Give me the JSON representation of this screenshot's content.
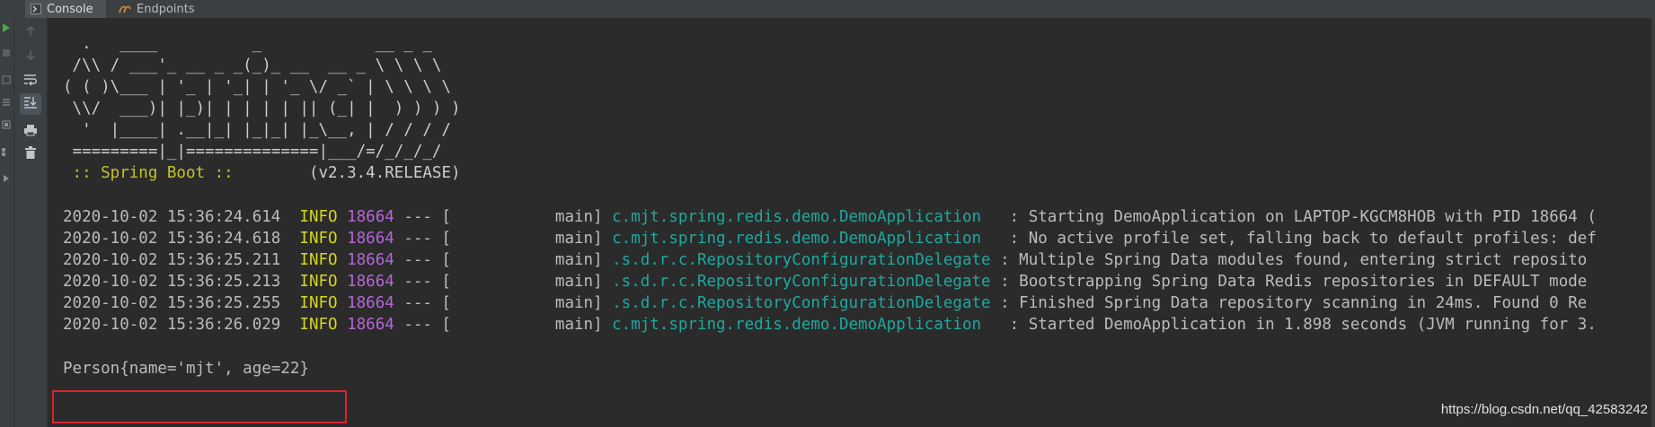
{
  "tabs": [
    {
      "label": "Console",
      "icon": "console-icon",
      "active": true
    },
    {
      "label": "Endpoints",
      "icon": "endpoints-icon",
      "active": false
    }
  ],
  "toolbar": {
    "buttons": [
      {
        "name": "scroll-up-button",
        "icon": "arrow-up-icon"
      },
      {
        "name": "scroll-down-button",
        "icon": "arrow-down-icon"
      },
      {
        "name": "soft-wrap-button",
        "icon": "soft-wrap-icon"
      },
      {
        "name": "scroll-to-end-button",
        "icon": "scroll-to-end-icon",
        "selected": true
      },
      {
        "name": "print-button",
        "icon": "print-icon"
      },
      {
        "name": "clear-all-button",
        "icon": "trash-icon"
      }
    ]
  },
  "banner": [
    "  .   ____          _            __ _ _",
    " /\\\\ / ___'_ __ _ _(_)_ __  __ _ \\ \\ \\ \\",
    "( ( )\\___ | '_ | '_| | '_ \\/ _` | \\ \\ \\ \\",
    " \\\\/  ___)| |_)| | | | | || (_| |  ) ) ) )",
    "  '  |____| .__|_| |_|_| |_\\__, | / / / /",
    " =========|_|==============|___/=/_/_/_/"
  ],
  "spring_line": {
    "label": " :: Spring Boot :: ",
    "version": "       (v2.3.4.RELEASE)"
  },
  "log_lines": [
    {
      "timestamp": "2020-10-02 15:36:24.614",
      "level": "INFO",
      "pid": "18664",
      "sep": " --- [           main] ",
      "logger": "c.mjt.spring.redis.demo.DemoApplication  ",
      "message": " : Starting DemoApplication on LAPTOP-KGCM8HOB with PID 18664 ("
    },
    {
      "timestamp": "2020-10-02 15:36:24.618",
      "level": "INFO",
      "pid": "18664",
      "sep": " --- [           main] ",
      "logger": "c.mjt.spring.redis.demo.DemoApplication  ",
      "message": " : No active profile set, falling back to default profiles: def"
    },
    {
      "timestamp": "2020-10-02 15:36:25.211",
      "level": "INFO",
      "pid": "18664",
      "sep": " --- [           main] ",
      "logger": ".s.d.r.c.RepositoryConfigurationDelegate",
      "message": " : Multiple Spring Data modules found, entering strict reposito"
    },
    {
      "timestamp": "2020-10-02 15:36:25.213",
      "level": "INFO",
      "pid": "18664",
      "sep": " --- [           main] ",
      "logger": ".s.d.r.c.RepositoryConfigurationDelegate",
      "message": " : Bootstrapping Spring Data Redis repositories in DEFAULT mode"
    },
    {
      "timestamp": "2020-10-02 15:36:25.255",
      "level": "INFO",
      "pid": "18664",
      "sep": " --- [           main] ",
      "logger": ".s.d.r.c.RepositoryConfigurationDelegate",
      "message": " : Finished Spring Data repository scanning in 24ms. Found 0 Re"
    },
    {
      "timestamp": "2020-10-02 15:36:26.029",
      "level": "INFO",
      "pid": "18664",
      "sep": " --- [           main] ",
      "logger": "c.mjt.spring.redis.demo.DemoApplication  ",
      "message": " : Started DemoApplication in 1.898 seconds (JVM running for 3."
    }
  ],
  "output_line": "Person{name='mjt', age=22}",
  "watermark": "https://blog.csdn.net/qq_42583242",
  "colors": {
    "background": "#2b2b2b",
    "info": "#d6d61c",
    "pid": "#b565d8",
    "logger": "#1ba9a0",
    "highlight_border": "#d9262b"
  }
}
